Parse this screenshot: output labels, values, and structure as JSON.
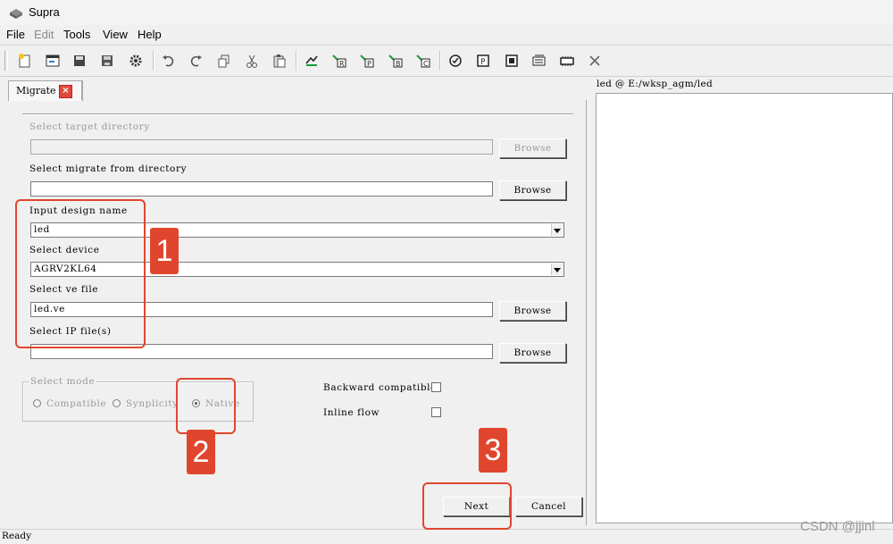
{
  "window": {
    "title": "Supra"
  },
  "menu": [
    {
      "label": "File",
      "enabled": true
    },
    {
      "label": "Edit",
      "enabled": false
    },
    {
      "label": "Tools",
      "enabled": true
    },
    {
      "label": "View",
      "enabled": true
    },
    {
      "label": "Help",
      "enabled": true
    }
  ],
  "toolbar": {
    "icons": [
      "new-project-icon",
      "open-icon",
      "save-icon",
      "save-as-icon",
      "settings-icon",
      "undo-icon",
      "redo-icon",
      "copy-icon",
      "cut-icon",
      "paste-icon",
      "run-flow-icon",
      "flow-r-icon",
      "flow-p-icon",
      "flow-b-icon",
      "flow-c-icon",
      "check-icon",
      "view-p-icon",
      "chip-icon",
      "programmer-icon",
      "board-icon",
      "close-icon"
    ]
  },
  "tab": {
    "label": "Migrate",
    "close": "×"
  },
  "form": {
    "target_dir": {
      "label": "Select target directory",
      "value": "",
      "browse": "Browse"
    },
    "from_dir": {
      "label": "Select migrate from directory",
      "value": "",
      "browse": "Browse"
    },
    "design_name": {
      "label": "Input design name",
      "value": "led"
    },
    "device": {
      "label": "Select device",
      "value": "AGRV2KL64"
    },
    "ve_file": {
      "label": "Select ve file",
      "value": "led.ve",
      "browse": "Browse"
    },
    "ip_files": {
      "label": "Select IP file(s)",
      "value": "",
      "browse": "Browse"
    },
    "mode": {
      "legend": "Select mode",
      "options": [
        "Compatible",
        "Synplicity",
        "Native"
      ],
      "selected": "Native"
    },
    "backward_compatible": {
      "label": "Backward compatible",
      "checked": false
    },
    "inline_flow": {
      "label": "Inline flow",
      "checked": false
    },
    "next": "Next",
    "cancel": "Cancel"
  },
  "right_pane": {
    "title": "led @ E:/wksp_agm/led"
  },
  "status": "Ready",
  "watermark": "CSDN @jjinl",
  "annotations": [
    "1",
    "2",
    "3"
  ],
  "colors": {
    "annotation": "#e0462e"
  }
}
